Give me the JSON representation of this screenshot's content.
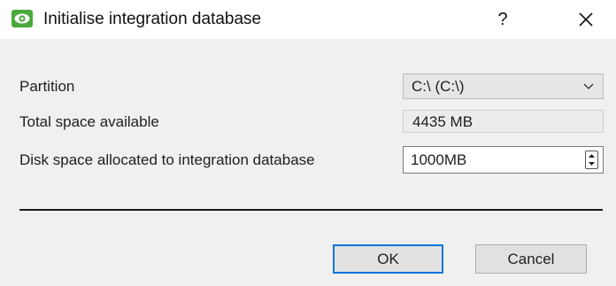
{
  "window": {
    "title": "Initialise integration database",
    "icon": "eye-app-icon",
    "help_label": "?",
    "close_label": "✕"
  },
  "form": {
    "partition": {
      "label": "Partition",
      "selected": "C:\\ (C:\\)"
    },
    "total_space": {
      "label": "Total space available",
      "value": "4435 MB"
    },
    "disk_allocated": {
      "label": "Disk space allocated to integration database",
      "value": "1000MB"
    }
  },
  "buttons": {
    "ok": "OK",
    "cancel": "Cancel"
  },
  "colors": {
    "accent": "#0078d7",
    "app_icon": "#4aa83c"
  }
}
